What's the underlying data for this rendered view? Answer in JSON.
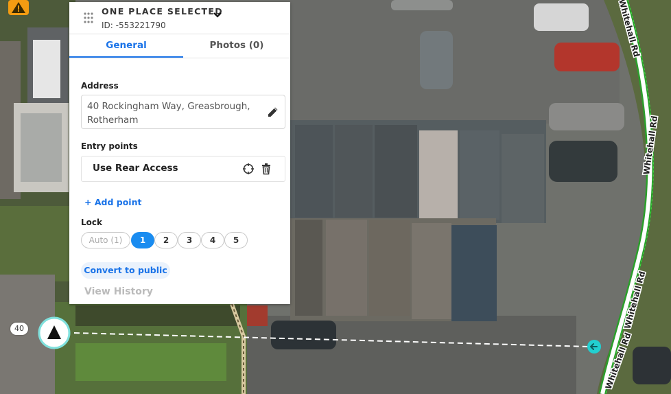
{
  "panel": {
    "title": "ONE PLACE SELECTED",
    "place_id": "ID: -553221790",
    "tabs": {
      "general": "General",
      "photos": "Photos (0)"
    },
    "address_label": "Address",
    "address_value": "40 Rockingham Way, Greasbrough, Rotherham",
    "entry_points_label": "Entry points",
    "entry_point_name": "Use Rear Access",
    "add_point": "+ Add point",
    "lock_label": "Lock",
    "lock_options": [
      "Auto (1)",
      "1",
      "2",
      "3",
      "4",
      "5"
    ],
    "lock_selected": "1",
    "convert_button": "Convert to public",
    "view_history": "View History"
  },
  "map": {
    "house_number": "40",
    "road_name_1": "Whitehall Rd",
    "road_name_2": "Whitehall Rd",
    "road_name_3": "Whitehall Rd",
    "road_name_4": "Whitehall Rd"
  },
  "icons": {
    "grip": "drag-handle-icon",
    "chevron": "chevron-down-icon",
    "edit": "pencil-icon",
    "target": "crosshair-icon",
    "delete": "trash-icon",
    "warning": "warning-icon",
    "arrow": "navigation-arrow-icon",
    "entry_marker": "arrow-left-icon"
  },
  "colors": {
    "accent": "#1a73e8",
    "lock_selected": "#1a8cf0",
    "road_outline": "#3ccc3c",
    "entry_marker": "#22cfd0",
    "warning": "#f39c12"
  }
}
